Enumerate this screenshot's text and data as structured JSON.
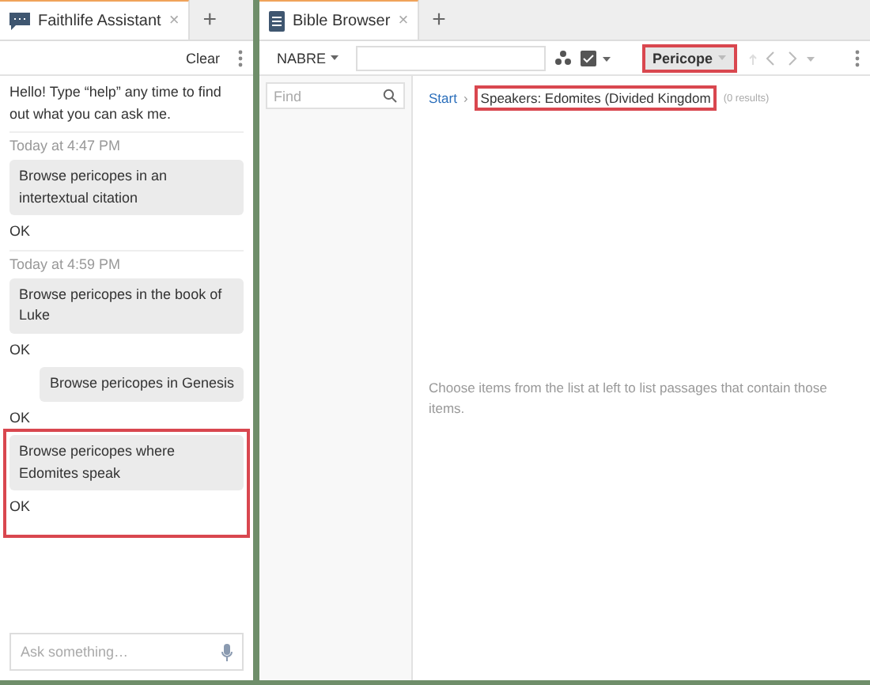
{
  "left_panel": {
    "tab": {
      "title": "Faithlife Assistant",
      "close": "×",
      "selected": true
    },
    "new_tab": "+",
    "clear": "Clear",
    "messages": [
      {
        "kind": "bot",
        "text": "Hello! Type “help” any time to find out what you can ask me."
      },
      {
        "kind": "time",
        "text": "Today at 4:47 PM"
      },
      {
        "kind": "user",
        "text": "Browse pericopes in an intertextual citation",
        "highlighted": false
      },
      {
        "kind": "bot",
        "text": "OK"
      },
      {
        "kind": "time",
        "text": "Today at 4:59 PM"
      },
      {
        "kind": "user",
        "text": "Browse pericopes in the book of Luke",
        "highlighted": false
      },
      {
        "kind": "bot",
        "text": "OK"
      },
      {
        "kind": "user",
        "text": "Browse pericopes in Genesis",
        "highlighted": false
      },
      {
        "kind": "bot",
        "text": "OK"
      },
      {
        "kind": "user",
        "text": "Browse pericopes where Edomites speak",
        "highlighted": true
      },
      {
        "kind": "bot",
        "text": "OK"
      }
    ],
    "input": {
      "placeholder": "Ask something…"
    }
  },
  "right_panel": {
    "tab": {
      "title": "Bible Browser",
      "close": "×",
      "selected": true
    },
    "new_tab": "+",
    "toolbar": {
      "version": "NABRE",
      "pericope": {
        "label": "Pericope",
        "highlighted": true
      }
    },
    "find": {
      "placeholder": "Find"
    },
    "breadcrumb": {
      "start": "Start",
      "separator": "›",
      "current": "Speakers: Edomites (Divided Kingdom",
      "current_highlighted": true,
      "count": "(0 results)"
    },
    "empty_message": "Choose items from the list at left to list passages that contain those items."
  }
}
